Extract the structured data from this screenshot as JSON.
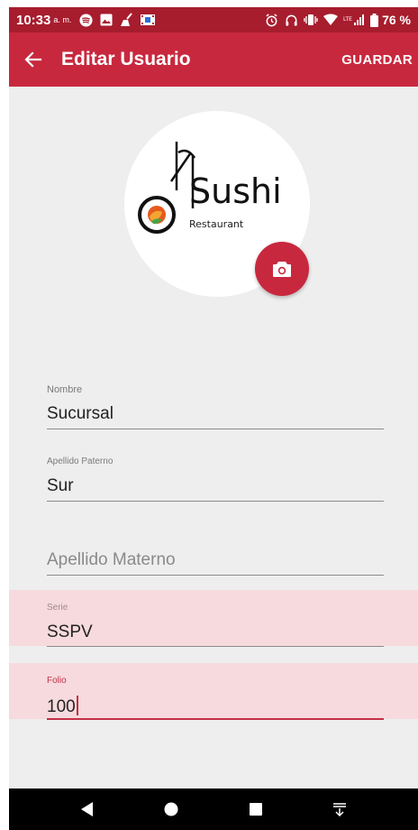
{
  "status_bar": {
    "time": "10:33",
    "ampm": "a. m.",
    "battery": "76 %",
    "left_icons": [
      "spotify-icon",
      "image-icon",
      "broom-icon",
      "film-icon"
    ],
    "right_icons": [
      "alarm-icon",
      "headset-icon",
      "vibrate-icon",
      "wifi-icon",
      "lte-signal-icon",
      "battery-icon"
    ]
  },
  "appbar": {
    "title": "Editar Usuario",
    "save_label": "GUARDAR",
    "back_icon": "arrow-back-icon"
  },
  "avatar": {
    "logo_text": "Sushi",
    "logo_subtext": "Restaurant",
    "camera_icon": "camera-icon"
  },
  "form": {
    "nombre": {
      "label": "Nombre",
      "value": "Sucursal"
    },
    "apellido_paterno": {
      "label": "Apellido Paterno",
      "value": "Sur"
    },
    "apellido_materno": {
      "placeholder": "Apellido Materno"
    },
    "serie": {
      "label": "Serie",
      "value": "SSPV",
      "state": "error"
    },
    "folio": {
      "label": "Folio",
      "value": "100",
      "state": "error-focused"
    }
  },
  "colors": {
    "status_bar": "#a71d2e",
    "app_bar": "#c8283e",
    "accent": "#c23046",
    "error_background": "#f6dadd",
    "page_background": "#eeeeee"
  },
  "nav_bar": {
    "icons": [
      "back-triangle-icon",
      "home-circle-icon",
      "recents-square-icon",
      "notifications-down-icon"
    ]
  }
}
